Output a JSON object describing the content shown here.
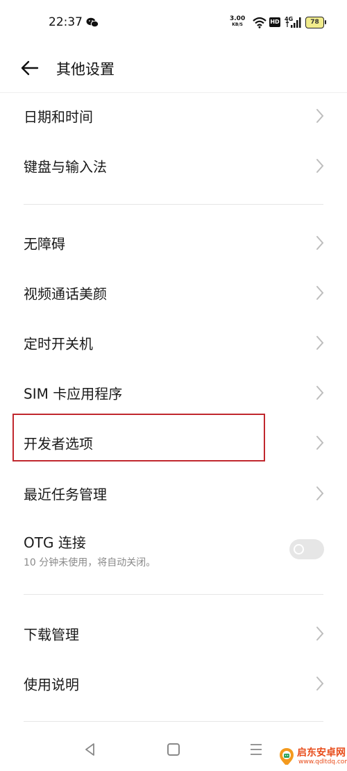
{
  "status_bar": {
    "time": "22:37",
    "net_speed_value": "3.00",
    "net_speed_unit": "KB/S",
    "hd_label": "HD",
    "battery_level": "78",
    "icons": [
      "wechat-icon",
      "wifi-icon",
      "hd-icon",
      "signal-4g-icon",
      "battery-icon"
    ]
  },
  "header": {
    "back_icon": "arrow-left-icon",
    "title": "其他设置"
  },
  "settings": {
    "group1": [
      {
        "label": "日期和时间"
      },
      {
        "label": "键盘与输入法"
      }
    ],
    "group2": [
      {
        "label": "无障碍"
      },
      {
        "label": "视频通话美颜"
      },
      {
        "label": "定时开关机"
      },
      {
        "label": "SIM 卡应用程序"
      },
      {
        "label": "开发者选项"
      },
      {
        "label": "最近任务管理"
      }
    ],
    "otg": {
      "label": "OTG 连接",
      "description": "10 分钟未使用，将自动关闭。",
      "enabled": false
    },
    "group3": [
      {
        "label": "下载管理"
      },
      {
        "label": "使用说明"
      }
    ]
  },
  "annotation": {
    "highlight_color": "#c0272d",
    "highlighted_item": "开发者选项"
  },
  "nav_bar": {
    "icons": [
      "nav-back-icon",
      "nav-home-icon",
      "nav-recents-icon"
    ]
  },
  "watermark": {
    "name": "启东安卓网",
    "url": "www.qdltdq.com"
  }
}
